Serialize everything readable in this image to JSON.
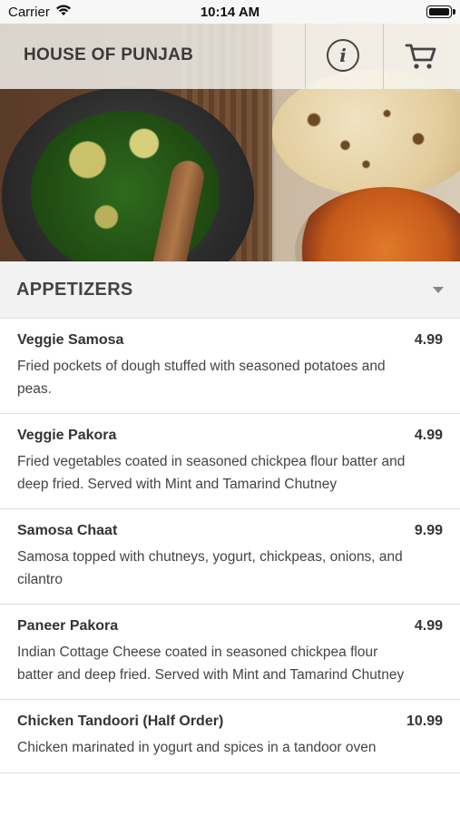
{
  "status_bar": {
    "carrier": "Carrier",
    "time": "10:14 AM"
  },
  "header": {
    "title": "HOUSE OF PUNJAB",
    "info_icon": "info-icon",
    "cart_icon": "cart-icon"
  },
  "section": {
    "title": "APPETIZERS",
    "icon": "chevron-down-icon"
  },
  "items": [
    {
      "name": "Veggie Samosa",
      "price": "4.99",
      "description": "Fried pockets of dough stuffed with seasoned potatoes and peas."
    },
    {
      "name": "Veggie Pakora",
      "price": "4.99",
      "description": "Fried vegetables coated in seasoned chickpea flour batter and deep fried. Served with Mint and Tamarind Chutney"
    },
    {
      "name": "Samosa Chaat",
      "price": "9.99",
      "description": "Samosa topped with chutneys, yogurt, chickpeas, onions, and cilantro"
    },
    {
      "name": "Paneer Pakora",
      "price": "4.99",
      "description": "Indian Cottage Cheese coated in seasoned chickpea flour batter and deep fried. Served with Mint and Tamarind Chutney"
    },
    {
      "name": "Chicken Tandoori (Half Order)",
      "price": "10.99",
      "description": "Chicken marinated in yogurt and spices in a tandoor oven"
    }
  ]
}
